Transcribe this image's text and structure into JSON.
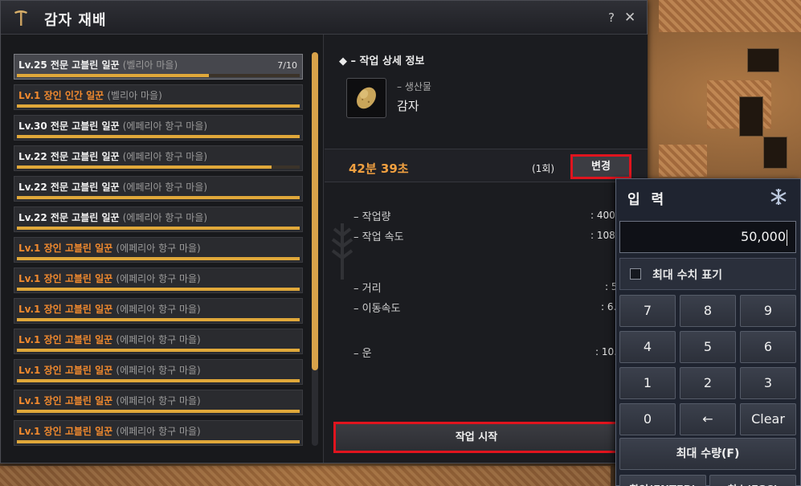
{
  "window": {
    "title": "감자 재배",
    "help": "?",
    "close": "✕",
    "icon": "pickaxe-icon"
  },
  "workers": [
    {
      "name": "Lv.25 전문 고블린 일꾼",
      "location": "(벨리아 마을)",
      "count": "7/10",
      "grade": "professional",
      "progress": 0.68
    },
    {
      "name": "Lv.1 장인 인간 일꾼",
      "location": "(벨리아 마을)",
      "count": "",
      "grade": "artisan",
      "progress": 1.0
    },
    {
      "name": "Lv.30 전문 고블린 일꾼",
      "location": "(에페리아 항구 마을)",
      "count": "",
      "grade": "professional",
      "progress": 1.0
    },
    {
      "name": "Lv.22 전문 고블린 일꾼",
      "location": "(에페리아 항구 마을)",
      "count": "",
      "grade": "professional",
      "progress": 0.9
    },
    {
      "name": "Lv.22 전문 고블린 일꾼",
      "location": "(에페리아 항구 마을)",
      "count": "",
      "grade": "professional",
      "progress": 1.0
    },
    {
      "name": "Lv.22 전문 고블린 일꾼",
      "location": "(에페리아 항구 마을)",
      "count": "",
      "grade": "professional",
      "progress": 1.0
    },
    {
      "name": "Lv.1 장인 고블린 일꾼",
      "location": "(에페리아 항구 마을)",
      "count": "",
      "grade": "artisan",
      "progress": 1.0
    },
    {
      "name": "Lv.1 장인 고블린 일꾼",
      "location": "(에페리아 항구 마을)",
      "count": "",
      "grade": "artisan",
      "progress": 1.0
    },
    {
      "name": "Lv.1 장인 고블린 일꾼",
      "location": "(에페리아 항구 마을)",
      "count": "",
      "grade": "artisan",
      "progress": 1.0
    },
    {
      "name": "Lv.1 장인 고블린 일꾼",
      "location": "(에페리아 항구 마을)",
      "count": "",
      "grade": "artisan",
      "progress": 1.0
    },
    {
      "name": "Lv.1 장인 고블린 일꾼",
      "location": "(에페리아 항구 마을)",
      "count": "",
      "grade": "artisan",
      "progress": 1.0
    },
    {
      "name": "Lv.1 장인 고블린 일꾼",
      "location": "(에페리아 항구 마을)",
      "count": "",
      "grade": "artisan",
      "progress": 1.0
    },
    {
      "name": "Lv.1 장인 고블린 일꾼",
      "location": "(에페리아 항구 마을)",
      "count": "",
      "grade": "artisan",
      "progress": 1.0
    }
  ],
  "detail": {
    "header": "◆  – 작업 상세 정보",
    "product_sub": "– 생산물",
    "product_name": "감자",
    "product_icon": "potato-icon",
    "time": "42분 39초",
    "count": "(1회)",
    "change_label": "변경",
    "stats": [
      {
        "label": "– 작업량",
        "value": ": 400."
      },
      {
        "label": "– 작업 속도",
        "value": ": 108."
      },
      {
        "label": "– 거리",
        "value": ": 5"
      },
      {
        "label": "– 이동속도",
        "value": ": 6."
      },
      {
        "label": "– 운",
        "value": ": 10."
      }
    ],
    "start_label": "작업 시작"
  },
  "numpad": {
    "title": "입 력",
    "icon": "snowflake-icon",
    "value": "50,000",
    "max_toggle_label": "최대 수치 표기",
    "max_toggle_checked": false,
    "keys": [
      "7",
      "8",
      "9",
      "4",
      "5",
      "6",
      "1",
      "2",
      "3",
      "0",
      "←",
      "Clear"
    ],
    "max_qty_label": "최대 수량(F)",
    "confirm_label": "확인(ENTER)",
    "cancel_label": "취소(ESC)"
  },
  "colors": {
    "accent_orange": "#f0a040",
    "progress_gold": "#e0a83a",
    "highlight_red": "#e0141e",
    "artisan_name": "#f28a2e"
  }
}
